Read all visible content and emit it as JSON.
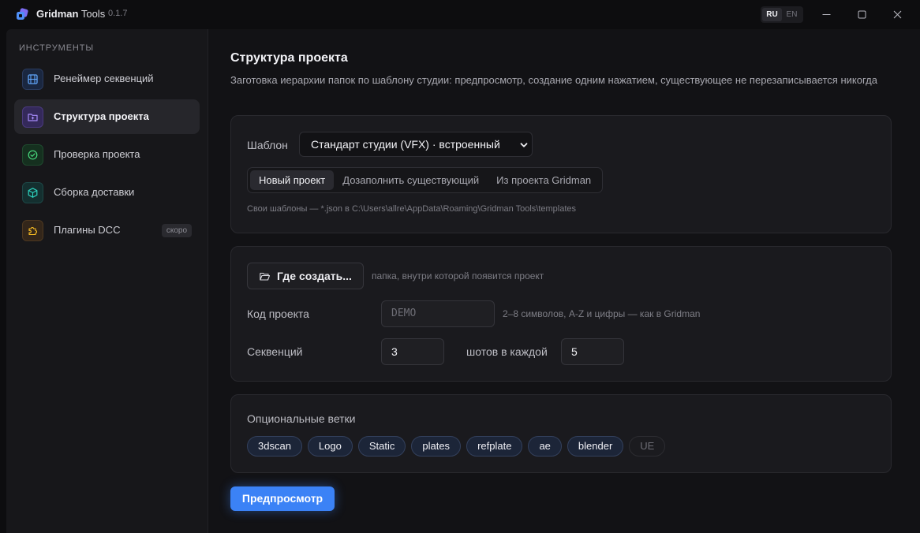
{
  "titlebar": {
    "app_name_bold": "Gridman",
    "app_name_rest": " Tools",
    "version": "0.1.7",
    "languages": [
      {
        "label": "RU",
        "active": true
      },
      {
        "label": "EN",
        "active": false
      }
    ]
  },
  "sidebar": {
    "heading": "ИНСТРУМЕНТЫ",
    "items": [
      {
        "label": "Ренеймер секвенций",
        "icon": "film-icon",
        "accent": "#3b82f6",
        "active": false
      },
      {
        "label": "Структура проекта",
        "icon": "folder-plus-icon",
        "accent": "#8b5cf6",
        "active": true
      },
      {
        "label": "Проверка проекта",
        "icon": "check-circle-icon",
        "accent": "#22c55e",
        "active": false
      },
      {
        "label": "Сборка доставки",
        "icon": "package-icon",
        "accent": "#14b8a6",
        "active": false
      },
      {
        "label": "Плагины DCC",
        "icon": "puzzle-icon",
        "accent": "#f59e0b",
        "active": false,
        "badge": "скоро"
      }
    ]
  },
  "main": {
    "title": "Структура проекта",
    "description": "Заготовка иерархии папок по шаблону студии: предпросмотр, создание одним нажатием, существующее не перезаписывается никогда",
    "template_card": {
      "label": "Шаблон",
      "selected": "Стандарт студии (VFX) · встроенный",
      "modes": [
        {
          "label": "Новый проект",
          "active": true
        },
        {
          "label": "Дозаполнить существующий",
          "active": false
        },
        {
          "label": "Из проекта Gridman",
          "active": false
        }
      ],
      "hint": "Свои шаблоны — *.json в C:\\Users\\allre\\AppData\\Roaming\\Gridman Tools\\templates"
    },
    "params_card": {
      "where_button": "Где создать...",
      "where_hint": "папка, внутри которой появится проект",
      "code_label": "Код проекта",
      "code_placeholder": "DEMO",
      "code_hint": "2–8 символов, A-Z и цифры — как в Gridman",
      "seq_label": "Секвенций",
      "seq_value": "3",
      "shots_label": "шотов в каждой",
      "shots_value": "5"
    },
    "branches_card": {
      "label": "Опциональные ветки",
      "chips": [
        {
          "label": "3dscan",
          "enabled": true
        },
        {
          "label": "Logo",
          "enabled": true
        },
        {
          "label": "Static",
          "enabled": true
        },
        {
          "label": "plates",
          "enabled": true
        },
        {
          "label": "refplate",
          "enabled": true
        },
        {
          "label": "ae",
          "enabled": true
        },
        {
          "label": "blender",
          "enabled": true
        },
        {
          "label": "UE",
          "enabled": false
        }
      ]
    },
    "preview_button": "Предпросмотр"
  },
  "colors": {
    "accent": "#3b82f6"
  }
}
